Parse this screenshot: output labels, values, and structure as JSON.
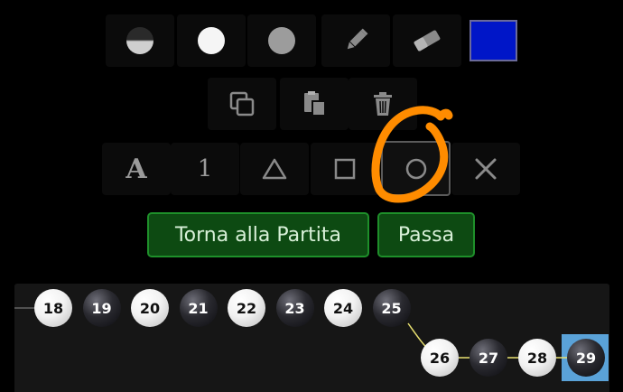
{
  "toolbar": {
    "row1": [
      {
        "name": "half-stone-icon"
      },
      {
        "name": "white-stone-icon"
      },
      {
        "name": "gray-stone-icon"
      },
      {
        "name": "pencil-icon"
      },
      {
        "name": "eraser-icon"
      }
    ],
    "color_swatch": "#0016c8",
    "row2": [
      {
        "name": "copy-icon"
      },
      {
        "name": "paste-icon"
      },
      {
        "name": "trash-icon"
      }
    ],
    "row3": [
      {
        "name": "letter-tool",
        "label": "A"
      },
      {
        "name": "number-tool",
        "label": "1"
      },
      {
        "name": "triangle-icon"
      },
      {
        "name": "square-icon"
      },
      {
        "name": "circle-icon",
        "selected": true
      },
      {
        "name": "close-icon"
      }
    ]
  },
  "actions": {
    "return_label": "Torna alla Partita",
    "pass_label": "Passa"
  },
  "colors": {
    "accent_green": "#0d4a12",
    "annotation_orange": "#ff8c00",
    "highlight_blue": "#5aa2d8",
    "line_yellow": "#e8e070"
  },
  "game_tree": {
    "moves": [
      {
        "n": "18",
        "color": "white"
      },
      {
        "n": "19",
        "color": "black"
      },
      {
        "n": "20",
        "color": "white"
      },
      {
        "n": "21",
        "color": "black"
      },
      {
        "n": "22",
        "color": "white"
      },
      {
        "n": "23",
        "color": "black"
      },
      {
        "n": "24",
        "color": "white"
      },
      {
        "n": "25",
        "color": "black"
      },
      {
        "n": "26",
        "color": "white"
      },
      {
        "n": "27",
        "color": "black"
      },
      {
        "n": "28",
        "color": "white"
      },
      {
        "n": "29",
        "color": "black",
        "current": true
      }
    ]
  }
}
